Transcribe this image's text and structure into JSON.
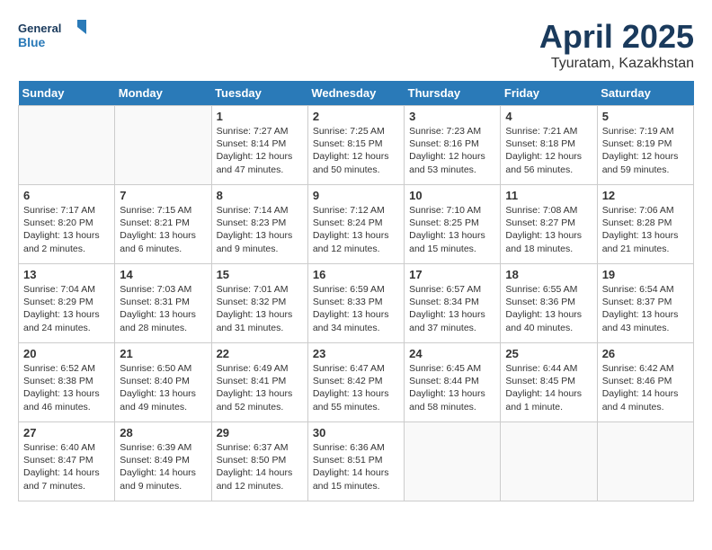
{
  "header": {
    "logo_general": "General",
    "logo_blue": "Blue",
    "month_title": "April 2025",
    "location": "Tyuratam, Kazakhstan"
  },
  "weekdays": [
    "Sunday",
    "Monday",
    "Tuesday",
    "Wednesday",
    "Thursday",
    "Friday",
    "Saturday"
  ],
  "weeks": [
    [
      {
        "day": "",
        "info": ""
      },
      {
        "day": "",
        "info": ""
      },
      {
        "day": "1",
        "info": "Sunrise: 7:27 AM\nSunset: 8:14 PM\nDaylight: 12 hours and 47 minutes."
      },
      {
        "day": "2",
        "info": "Sunrise: 7:25 AM\nSunset: 8:15 PM\nDaylight: 12 hours and 50 minutes."
      },
      {
        "day": "3",
        "info": "Sunrise: 7:23 AM\nSunset: 8:16 PM\nDaylight: 12 hours and 53 minutes."
      },
      {
        "day": "4",
        "info": "Sunrise: 7:21 AM\nSunset: 8:18 PM\nDaylight: 12 hours and 56 minutes."
      },
      {
        "day": "5",
        "info": "Sunrise: 7:19 AM\nSunset: 8:19 PM\nDaylight: 12 hours and 59 minutes."
      }
    ],
    [
      {
        "day": "6",
        "info": "Sunrise: 7:17 AM\nSunset: 8:20 PM\nDaylight: 13 hours and 2 minutes."
      },
      {
        "day": "7",
        "info": "Sunrise: 7:15 AM\nSunset: 8:21 PM\nDaylight: 13 hours and 6 minutes."
      },
      {
        "day": "8",
        "info": "Sunrise: 7:14 AM\nSunset: 8:23 PM\nDaylight: 13 hours and 9 minutes."
      },
      {
        "day": "9",
        "info": "Sunrise: 7:12 AM\nSunset: 8:24 PM\nDaylight: 13 hours and 12 minutes."
      },
      {
        "day": "10",
        "info": "Sunrise: 7:10 AM\nSunset: 8:25 PM\nDaylight: 13 hours and 15 minutes."
      },
      {
        "day": "11",
        "info": "Sunrise: 7:08 AM\nSunset: 8:27 PM\nDaylight: 13 hours and 18 minutes."
      },
      {
        "day": "12",
        "info": "Sunrise: 7:06 AM\nSunset: 8:28 PM\nDaylight: 13 hours and 21 minutes."
      }
    ],
    [
      {
        "day": "13",
        "info": "Sunrise: 7:04 AM\nSunset: 8:29 PM\nDaylight: 13 hours and 24 minutes."
      },
      {
        "day": "14",
        "info": "Sunrise: 7:03 AM\nSunset: 8:31 PM\nDaylight: 13 hours and 28 minutes."
      },
      {
        "day": "15",
        "info": "Sunrise: 7:01 AM\nSunset: 8:32 PM\nDaylight: 13 hours and 31 minutes."
      },
      {
        "day": "16",
        "info": "Sunrise: 6:59 AM\nSunset: 8:33 PM\nDaylight: 13 hours and 34 minutes."
      },
      {
        "day": "17",
        "info": "Sunrise: 6:57 AM\nSunset: 8:34 PM\nDaylight: 13 hours and 37 minutes."
      },
      {
        "day": "18",
        "info": "Sunrise: 6:55 AM\nSunset: 8:36 PM\nDaylight: 13 hours and 40 minutes."
      },
      {
        "day": "19",
        "info": "Sunrise: 6:54 AM\nSunset: 8:37 PM\nDaylight: 13 hours and 43 minutes."
      }
    ],
    [
      {
        "day": "20",
        "info": "Sunrise: 6:52 AM\nSunset: 8:38 PM\nDaylight: 13 hours and 46 minutes."
      },
      {
        "day": "21",
        "info": "Sunrise: 6:50 AM\nSunset: 8:40 PM\nDaylight: 13 hours and 49 minutes."
      },
      {
        "day": "22",
        "info": "Sunrise: 6:49 AM\nSunset: 8:41 PM\nDaylight: 13 hours and 52 minutes."
      },
      {
        "day": "23",
        "info": "Sunrise: 6:47 AM\nSunset: 8:42 PM\nDaylight: 13 hours and 55 minutes."
      },
      {
        "day": "24",
        "info": "Sunrise: 6:45 AM\nSunset: 8:44 PM\nDaylight: 13 hours and 58 minutes."
      },
      {
        "day": "25",
        "info": "Sunrise: 6:44 AM\nSunset: 8:45 PM\nDaylight: 14 hours and 1 minute."
      },
      {
        "day": "26",
        "info": "Sunrise: 6:42 AM\nSunset: 8:46 PM\nDaylight: 14 hours and 4 minutes."
      }
    ],
    [
      {
        "day": "27",
        "info": "Sunrise: 6:40 AM\nSunset: 8:47 PM\nDaylight: 14 hours and 7 minutes."
      },
      {
        "day": "28",
        "info": "Sunrise: 6:39 AM\nSunset: 8:49 PM\nDaylight: 14 hours and 9 minutes."
      },
      {
        "day": "29",
        "info": "Sunrise: 6:37 AM\nSunset: 8:50 PM\nDaylight: 14 hours and 12 minutes."
      },
      {
        "day": "30",
        "info": "Sunrise: 6:36 AM\nSunset: 8:51 PM\nDaylight: 14 hours and 15 minutes."
      },
      {
        "day": "",
        "info": ""
      },
      {
        "day": "",
        "info": ""
      },
      {
        "day": "",
        "info": ""
      }
    ]
  ]
}
